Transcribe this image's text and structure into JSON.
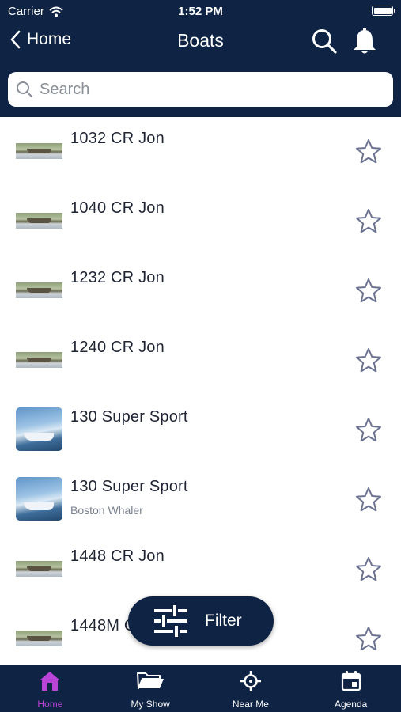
{
  "status_bar": {
    "carrier": "Carrier",
    "time": "1:52 PM"
  },
  "nav": {
    "back_label": "Home",
    "title": "Boats"
  },
  "search": {
    "placeholder": "Search",
    "value": ""
  },
  "boats": [
    {
      "name": "1032 CR Jon",
      "brand": "",
      "thumb": "jon-boat-photo"
    },
    {
      "name": "1040 CR Jon",
      "brand": "",
      "thumb": "jon-boat-photo"
    },
    {
      "name": "1232 CR Jon",
      "brand": "",
      "thumb": "jon-boat-photo"
    },
    {
      "name": "1240 CR Jon",
      "brand": "",
      "thumb": "jon-boat-photo"
    },
    {
      "name": "130 Super Sport",
      "brand": "",
      "thumb": "sport-boat-photo"
    },
    {
      "name": "130 Super Sport",
      "brand": "Boston Whaler",
      "thumb": "sport-boat-photo"
    },
    {
      "name": "1448 CR Jon",
      "brand": "",
      "thumb": "jon-boat-photo"
    },
    {
      "name": "1448M C",
      "brand": "",
      "thumb": "jon-boat-photo"
    }
  ],
  "filter_button": {
    "label": "Filter"
  },
  "tabs": [
    {
      "label": "Home",
      "icon": "home-icon",
      "active": true
    },
    {
      "label": "My Show",
      "icon": "folder-icon",
      "active": false
    },
    {
      "label": "Near Me",
      "icon": "crosshair-icon",
      "active": false
    },
    {
      "label": "Agenda",
      "icon": "calendar-icon",
      "active": false
    }
  ],
  "colors": {
    "nav_bg": "#0f2344",
    "active_tab": "#b845d8",
    "star": "#6b7190"
  }
}
